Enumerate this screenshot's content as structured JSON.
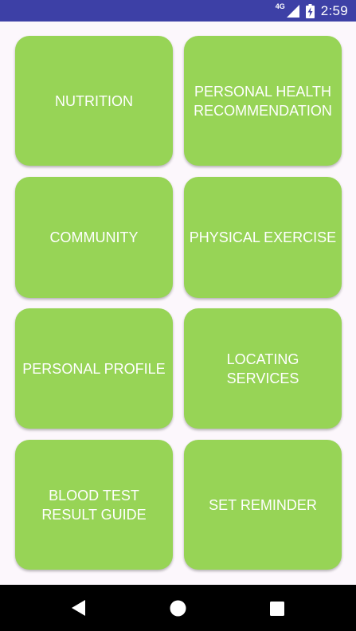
{
  "status_bar": {
    "network": "4G",
    "time": "2:59",
    "signal_icon": "signal-strength-icon",
    "battery_icon": "battery-charging-icon"
  },
  "tiles": [
    {
      "label": "NUTRITION"
    },
    {
      "label": "PERSONAL HEALTH RECOMMENDATION"
    },
    {
      "label": "COMMUNITY"
    },
    {
      "label": "PHYSICAL EXERCISE"
    },
    {
      "label": "PERSONAL PROFILE"
    },
    {
      "label": "LOCATING SERVICES"
    },
    {
      "label": "BLOOD TEST RESULT GUIDE"
    },
    {
      "label": "SET REMINDER"
    }
  ],
  "nav_bar": {
    "back_icon": "back-triangle-icon",
    "home_icon": "home-circle-icon",
    "recents_icon": "recents-square-icon"
  },
  "colors": {
    "status_bar": "#3d40a6",
    "tile": "#97d456",
    "background": "#fcf7fc",
    "nav_bar": "#000000"
  }
}
